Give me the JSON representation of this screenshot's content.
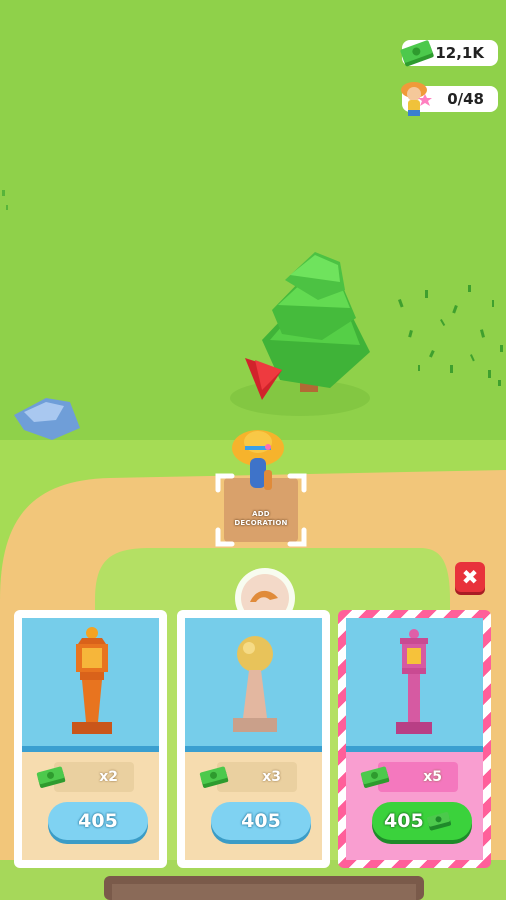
{
  "hud": {
    "money": "12,1K",
    "customers": "0/48",
    "money_icon": "cash-stack-icon",
    "customer_icon": "visitor-girl-icon"
  },
  "scene": {
    "add_decoration_label": "ADD\nDECORATION"
  },
  "shop": {
    "close_icon": "close-icon",
    "close_symbol": "✖",
    "items": [
      {
        "name": "orange-lantern",
        "multiplier": "x2",
        "price": "405",
        "buy_icon": ""
      },
      {
        "name": "ball-post",
        "multiplier": "x3",
        "price": "405",
        "buy_icon": ""
      },
      {
        "name": "pink-lantern",
        "multiplier": "x5",
        "price": "405",
        "buy_icon": "cash-icon",
        "highlighted": true
      }
    ]
  },
  "colors": {
    "grass": "#8fd14a",
    "path": "#f2c67a",
    "card_blue": "#76cdea",
    "card_beige": "#f6dcaf",
    "card_pink": "#f99ed0",
    "buy_blue": "#7fd2f2",
    "buy_green": "#3bd23c",
    "close_red": "#e8323b"
  }
}
